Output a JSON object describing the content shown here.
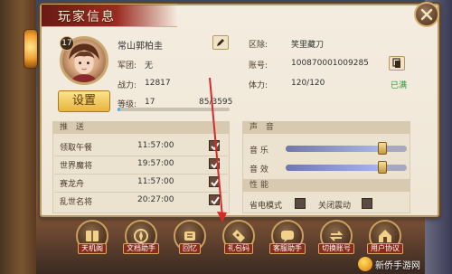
{
  "window": {
    "title": "玩家信息"
  },
  "player": {
    "level_badge": "17",
    "name": "常山郭柏圭",
    "settings_label": "设置",
    "fields_left": [
      {
        "label": "军团:",
        "value": "无"
      },
      {
        "label": "战力:",
        "value": "12817"
      },
      {
        "label": "等级:",
        "value": "17"
      }
    ],
    "exp_text": "85/3595",
    "exp_fraction": 0.024,
    "fields_right": [
      {
        "label": "区除:",
        "value": "笑里藏刀"
      },
      {
        "label": "账号:",
        "value": "100870001009285"
      },
      {
        "label": "体力:",
        "value": "120/120"
      }
    ],
    "stamina_status": "已满"
  },
  "push": {
    "header": "推 送",
    "items": [
      {
        "label": "领取午餐",
        "time": "11:57:00",
        "checked": true
      },
      {
        "label": "世界魔将",
        "time": "19:57:00",
        "checked": true
      },
      {
        "label": "赛龙舟",
        "time": "11:57:00",
        "checked": true
      },
      {
        "label": "乱世名将",
        "time": "20:27:00",
        "checked": true
      }
    ]
  },
  "sound": {
    "header": "声 音",
    "music_label": "音 乐",
    "music_level": 0.8,
    "effect_label": "音 效",
    "effect_level": 0.8
  },
  "performance": {
    "header": "性能",
    "power_saving_label": "省电模式",
    "power_saving_checked": false,
    "vibration_label": "关闭震动",
    "vibration_checked": false
  },
  "bottom_buttons": [
    {
      "label": "天机阁",
      "icon": "book-icon"
    },
    {
      "label": "文档助手",
      "icon": "compass-icon"
    },
    {
      "label": "回忆",
      "icon": "scroll-icon"
    },
    {
      "label": "礼包码",
      "icon": "ticket-icon"
    },
    {
      "label": "客服助手",
      "icon": "chat-icon"
    },
    {
      "label": "切换账号",
      "icon": "switch-icon"
    },
    {
      "label": "用户协议",
      "icon": "home-icon"
    }
  ],
  "watermark": {
    "text": "新侨手游网"
  },
  "colors": {
    "panel_bg": "#f4ecdf",
    "title_red": "#9a2a20",
    "check_green": "#2a9a3a",
    "gold": "#e8b440"
  }
}
